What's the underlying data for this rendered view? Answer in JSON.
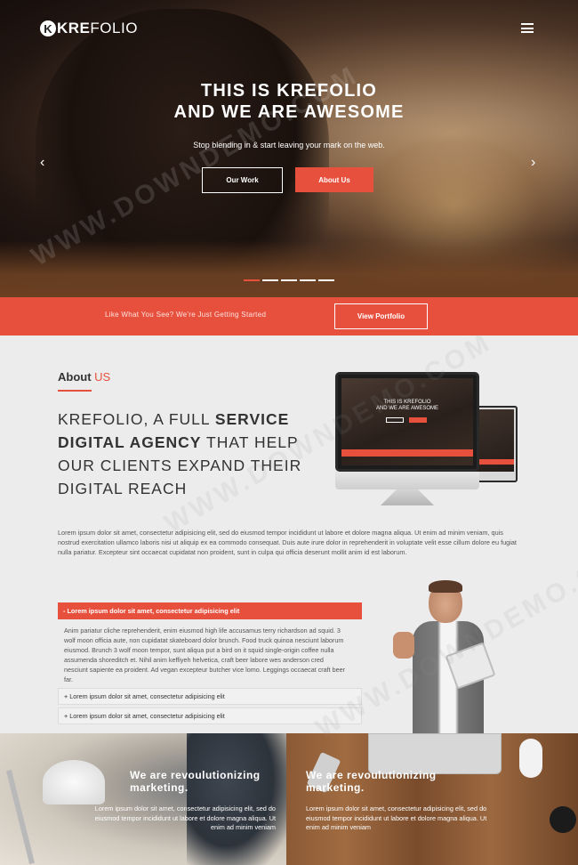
{
  "header": {
    "logo_mark": "K",
    "logo_bold": "KRE",
    "logo_rest": "FOLIO",
    "menu_icon": "hamburger-menu-icon"
  },
  "hero": {
    "title_line1_normal": "THIS IS ",
    "title_line1_bold": "KREFOLIO",
    "title_line2_normal": "AND WE ARE ",
    "title_line2_bold": "AWESOME",
    "subtitle": "Stop blending in & start leaving your mark on the web.",
    "btn_our_work": "Our Work",
    "btn_about_us": "About Us",
    "prev_arrow": "‹",
    "next_arrow": "›",
    "slides_count": 5,
    "active_slide": 1
  },
  "cta": {
    "text": "Like What You See? We're Just Getting Started",
    "button": "View Portfolio"
  },
  "about": {
    "title": "About ",
    "title_accent": "US",
    "heading_p1": "KREFOLIO, A FULL ",
    "heading_b1": "SERVICE",
    "heading_b2": "DIGITAL AGENCY",
    "heading_p2": " THAT HELP OUR CLIENTS EXPAND THEIR DIGITAL REACH",
    "monitor_text_line1": "THIS IS KREFOLIO",
    "monitor_text_line2": "AND WE ARE AWESOME",
    "apple_logo": "",
    "paragraph": "Lorem ipsum dolor sit amet, consectetur adipisicing elit, sed do eiusmod tempor incididunt ut labore et dolore magna aliqua. Ut enim ad minim veniam, quis nostrud exercitation ullamco laboris nisi ut aliquip ex ea commodo consequat. Duis aute irure dolor in reprehenderit in voluptate velit esse cillum dolore eu fugiat nulla pariatur. Excepteur sint occaecat cupidatat non proident, sunt in culpa qui officia deserunt mollit anim id est laborum."
  },
  "accordion": {
    "open_title": "- Lorem ipsum dolor sit amet, consectetur adipisicing elit",
    "open_body": "Anim pariatur cliche reprehenderit, enim eiusmod high life accusamus terry richardson ad squid. 3 wolf moon officia aute, non cupidatat skateboard dolor brunch. Food truck quinoa nesciunt laborum eiusmod. Brunch 3 wolf moon tempor, sunt aliqua put a bird on it squid single-origin coffee nulla assumenda shoreditch et. Nihil anim keffiyeh helvetica, craft beer labore wes anderson cred nesciunt sapiente ea proident. Ad vegan excepteur butcher vice lomo. Leggings occaecat craft beer far.",
    "items": [
      "+ Lorem ipsum dolor sit amet, consectetur adipisicing elit",
      "+ Lorem ipsum dolor sit amet, consectetur adipisicing elit"
    ]
  },
  "panels": {
    "left_heading": "We are revoulutionizing marketing.",
    "left_text": "Lorem ipsum dolor sit amet, consectetur adipisicing elit, sed do eiusmod tempor incididunt ut labore et dolore magna aliqua. Ut enim ad minim veniam",
    "right_heading": "We are revoulutionizing marketing.",
    "right_text": "Lorem ipsum dolor sit amet, consectetur adipisicing elit, sed do eiusmod tempor incididunt ut labore et dolore magna aliqua. Ut enim ad minim veniam"
  },
  "watermark": "WWW.DOWNDEMO.COM",
  "colors": {
    "accent": "#e8503e",
    "background": "#ececec",
    "text": "#333333"
  }
}
